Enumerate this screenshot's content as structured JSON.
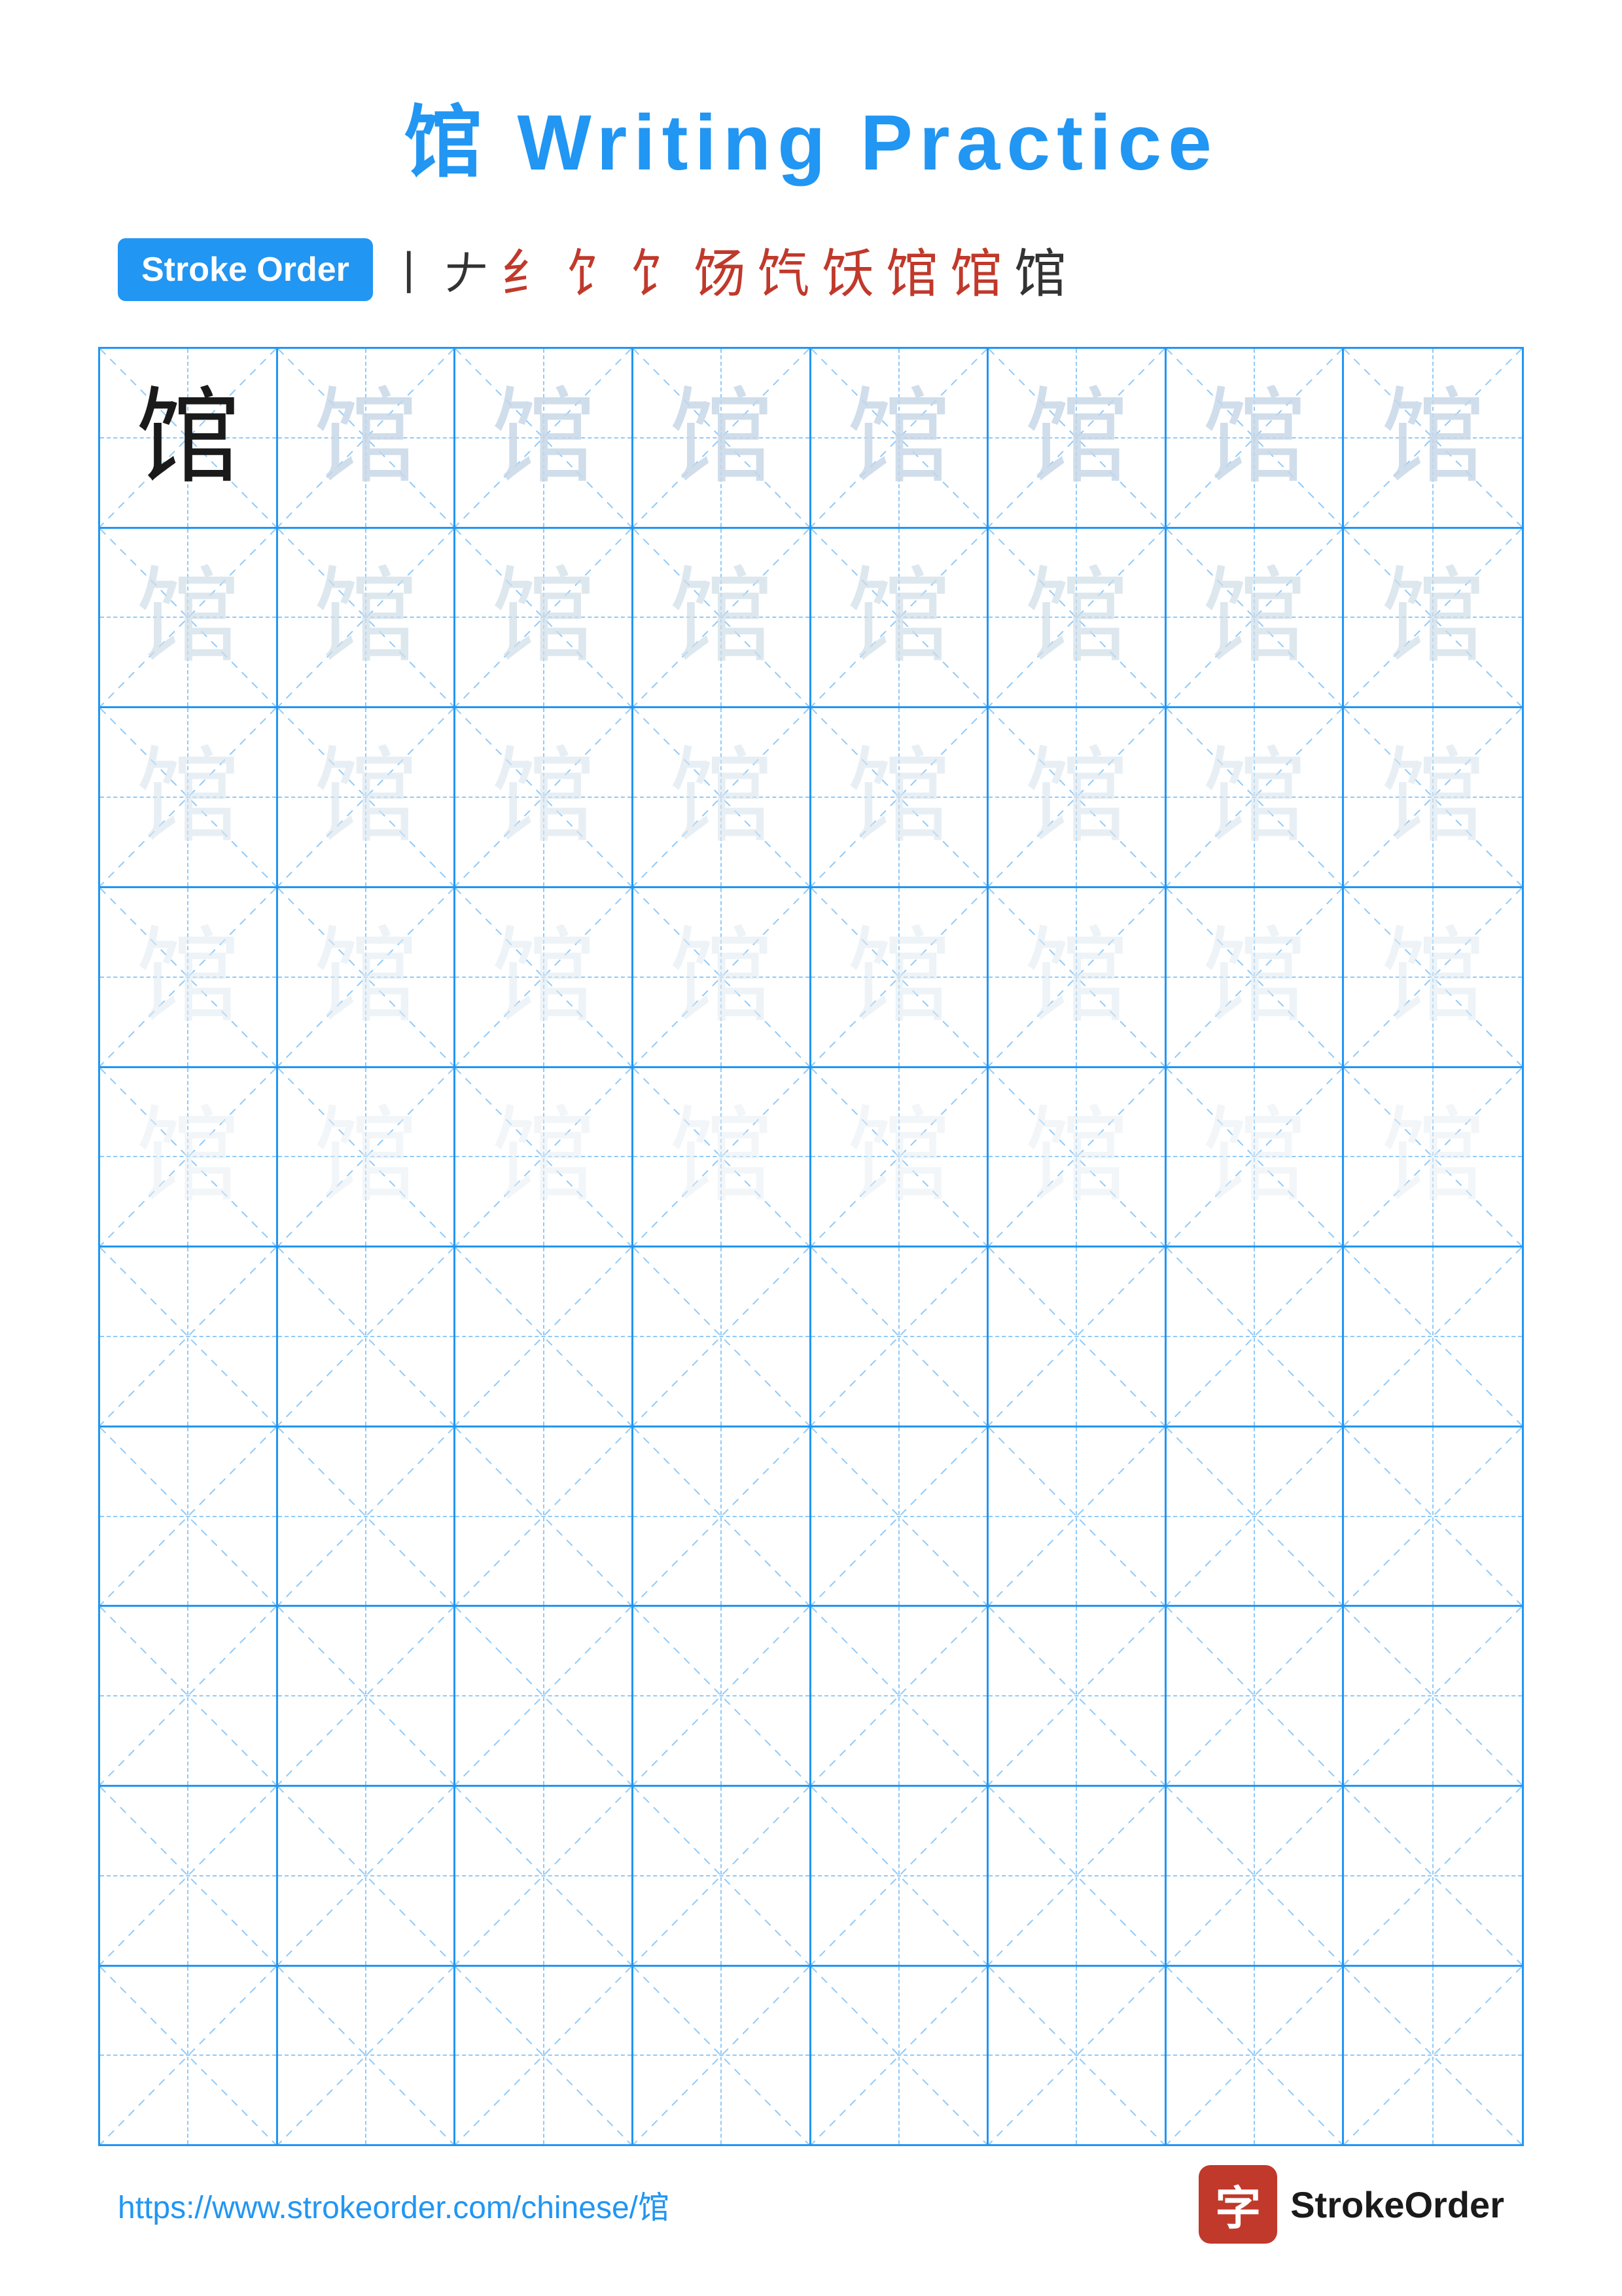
{
  "title": {
    "character": "馆",
    "label": "Writing Practice",
    "full": "馆 Writing Practice"
  },
  "stroke_order": {
    "badge_label": "Stroke Order",
    "strokes": [
      "丨",
      "丿",
      "乙",
      "乙",
      "𠃌",
      "𠃌",
      "㇀",
      "㇀",
      "馆",
      "馆",
      "馆"
    ]
  },
  "character": "馆",
  "grid": {
    "rows": 10,
    "cols": 8
  },
  "footer": {
    "url": "https://www.strokeorder.com/chinese/馆",
    "logo_char": "字",
    "logo_text": "StrokeOrder"
  },
  "colors": {
    "blue": "#2196F3",
    "red": "#c0392b",
    "grid_line": "#2196F3",
    "grid_dash": "#90CAF9"
  }
}
